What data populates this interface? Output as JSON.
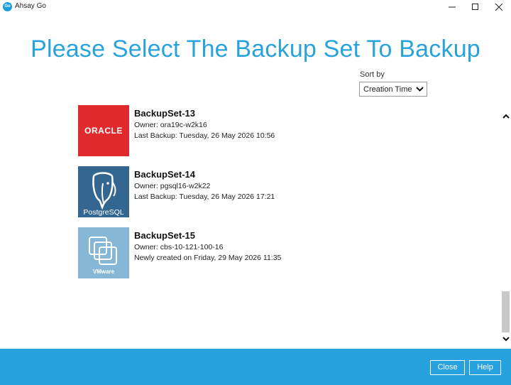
{
  "window": {
    "app_logo_text": "Go",
    "title": "Ahsay Go",
    "controls": [
      "minimize",
      "maximize",
      "close"
    ]
  },
  "page_title": "Please Select The Backup Set To Backup",
  "sort": {
    "label": "Sort by",
    "selected": "Creation Time"
  },
  "backup_sets": [
    {
      "name": "BackupSet-13",
      "owner": "Owner: ora19c-w2k16",
      "status": "Last Backup: Tuesday, 26 May 2026 10:56",
      "logo": "oracle-logo",
      "logo_text": "ORACLE",
      "logo_color": "#e02a2d"
    },
    {
      "name": "BackupSet-14",
      "owner": "Owner: pgsql16-w2k22",
      "status": "Last Backup: Tuesday, 26 May 2026 17:21",
      "logo": "postgresql-logo",
      "logo_text": "PostgreSQL",
      "logo_color": "#336791"
    },
    {
      "name": "BackupSet-15",
      "owner": "Owner: cbs-10-121-100-16",
      "status": "Newly created on Friday, 29 May 2026 11:35",
      "logo": "vmware-logo",
      "logo_text": "VMware",
      "logo_color": "#87b7d6"
    }
  ],
  "footer": {
    "close_label": "Close",
    "help_label": "Help",
    "background_color": "#27a2df"
  }
}
